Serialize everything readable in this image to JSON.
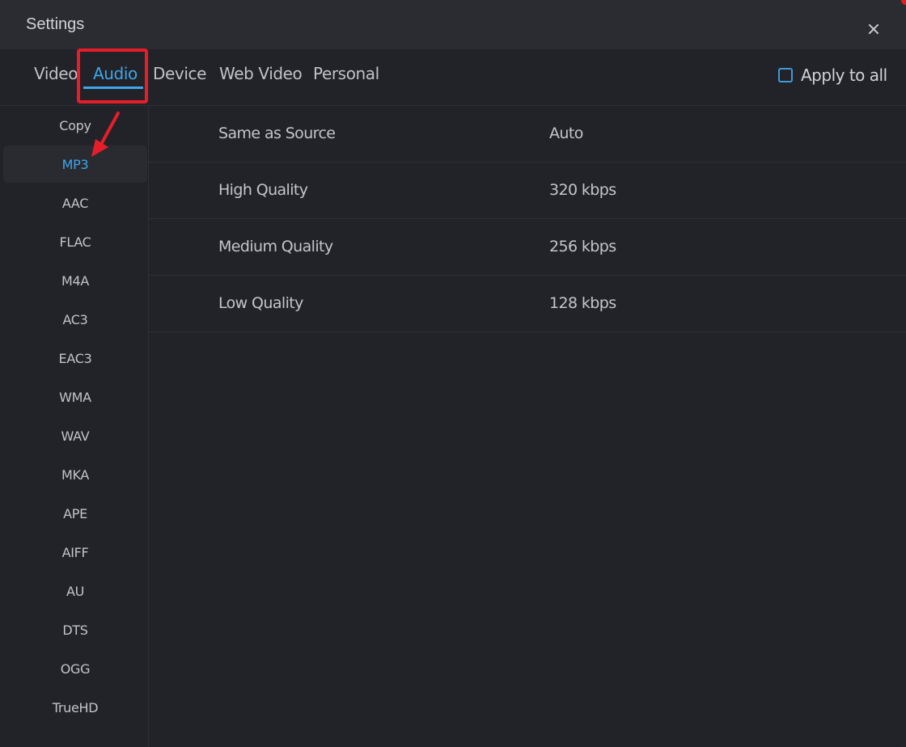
{
  "window": {
    "title": "Settings",
    "close_icon": "close-icon"
  },
  "tabs": [
    {
      "label": "Video",
      "active": false
    },
    {
      "label": "Audio",
      "active": true
    },
    {
      "label": "Device",
      "active": false
    },
    {
      "label": "Web Video",
      "active": false
    },
    {
      "label": "Personal",
      "active": false
    }
  ],
  "apply_to_all": {
    "label": "Apply to all",
    "checked": false
  },
  "formats": [
    {
      "label": "Copy",
      "selected": false
    },
    {
      "label": "MP3",
      "selected": true
    },
    {
      "label": "AAC",
      "selected": false
    },
    {
      "label": "FLAC",
      "selected": false
    },
    {
      "label": "M4A",
      "selected": false
    },
    {
      "label": "AC3",
      "selected": false
    },
    {
      "label": "EAC3",
      "selected": false
    },
    {
      "label": "WMA",
      "selected": false
    },
    {
      "label": "WAV",
      "selected": false
    },
    {
      "label": "MKA",
      "selected": false
    },
    {
      "label": "APE",
      "selected": false
    },
    {
      "label": "AIFF",
      "selected": false
    },
    {
      "label": "AU",
      "selected": false
    },
    {
      "label": "DTS",
      "selected": false
    },
    {
      "label": "OGG",
      "selected": false
    },
    {
      "label": "TrueHD",
      "selected": false
    }
  ],
  "quality_options": [
    {
      "name": "Same as Source",
      "value": "Auto"
    },
    {
      "name": "High Quality",
      "value": "320 kbps"
    },
    {
      "name": "Medium Quality",
      "value": "256 kbps"
    },
    {
      "name": "Low Quality",
      "value": "128 kbps"
    }
  ],
  "annotations": {
    "highlight_color": "#e51e2a",
    "accent_color": "#3ea6ea"
  }
}
